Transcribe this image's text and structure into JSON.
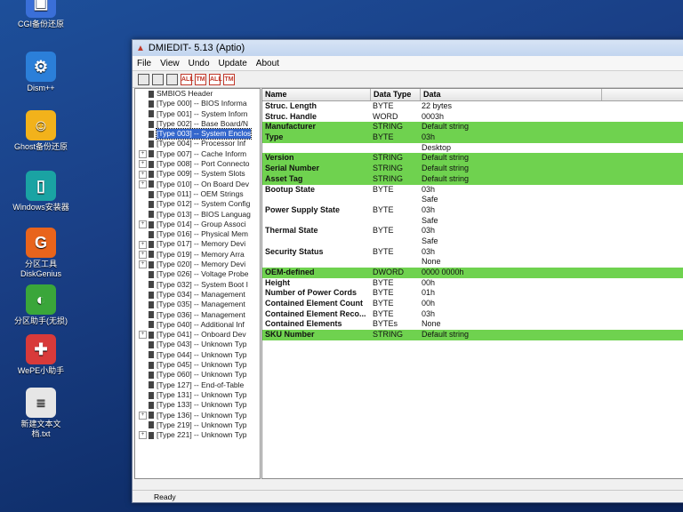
{
  "desktop": {
    "icons": [
      {
        "label": "CGI备份还原",
        "glyph": "▣",
        "color": "#3a6fd8",
        "icon": "backup-icon"
      },
      {
        "label": "Dism++",
        "glyph": "⚙",
        "color": "#2b7fd9",
        "icon": "gear-icon"
      },
      {
        "label": "Ghost备份还原",
        "glyph": "☺",
        "color": "#f2b21b",
        "icon": "ghost-icon"
      },
      {
        "label": "Windows安装器",
        "glyph": "▯",
        "color": "#1aa3a3",
        "icon": "installer-icon"
      },
      {
        "label": "分区工具DiskGenius",
        "glyph": "G",
        "color": "#e8641c",
        "icon": "diskgenius-icon"
      },
      {
        "label": "分区助手(无损)",
        "glyph": "◐",
        "color": "#3aa63a",
        "icon": "partition-assistant-icon"
      },
      {
        "label": "WePE小助手",
        "glyph": "✚",
        "color": "#d83a3a",
        "icon": "lifebuoy-icon"
      },
      {
        "label": "新建文本文档.txt",
        "glyph": "≡",
        "color": "#e6e6e6",
        "icon": "text-file-icon"
      }
    ]
  },
  "window": {
    "title": "DMIEDIT- 5.13 (Aptio)",
    "menu": [
      "File",
      "View",
      "Undo",
      "Update",
      "About"
    ],
    "toolbar": [
      {
        "label": "",
        "icon": "save-icon",
        "style": ""
      },
      {
        "label": "",
        "icon": "save-all-icon",
        "style": ""
      },
      {
        "label": "",
        "icon": "export-icon",
        "style": ""
      },
      {
        "label": "ALL",
        "icon": "update-all-icon",
        "style": "red"
      },
      {
        "label": "TM",
        "icon": "update-tm-icon",
        "style": "red"
      },
      {
        "label": "ALL",
        "icon": "undo-all-icon",
        "style": "red"
      },
      {
        "label": "TM",
        "icon": "undo-tm-icon",
        "style": "red"
      }
    ],
    "status": "Ready"
  },
  "tree": [
    {
      "label": "SMBIOS Header",
      "exp": false,
      "selected": false
    },
    {
      "label": "[Type 000] -- BIOS Informa",
      "exp": false,
      "selected": false
    },
    {
      "label": "[Type 001] -- System Inforn",
      "exp": false,
      "selected": false
    },
    {
      "label": "[Type 002] -- Base Board/N",
      "exp": false,
      "selected": false
    },
    {
      "label": "[Type 003] -- System Enclos",
      "exp": false,
      "selected": true
    },
    {
      "label": "[Type 004] -- Processor Inf",
      "exp": false,
      "selected": false
    },
    {
      "label": "[Type 007] -- Cache Inform",
      "exp": true,
      "selected": false
    },
    {
      "label": "[Type 008] -- Port Connecto",
      "exp": true,
      "selected": false
    },
    {
      "label": "[Type 009] -- System Slots",
      "exp": true,
      "selected": false
    },
    {
      "label": "[Type 010] -- On Board Dev",
      "exp": true,
      "selected": false
    },
    {
      "label": "[Type 011] -- OEM Strings",
      "exp": false,
      "selected": false
    },
    {
      "label": "[Type 012] -- System Config",
      "exp": false,
      "selected": false
    },
    {
      "label": "[Type 013] -- BIOS Languag",
      "exp": false,
      "selected": false
    },
    {
      "label": "[Type 014] -- Group Associ",
      "exp": true,
      "selected": false
    },
    {
      "label": "[Type 016] -- Physical Mem",
      "exp": false,
      "selected": false
    },
    {
      "label": "[Type 017] -- Memory Devi",
      "exp": true,
      "selected": false
    },
    {
      "label": "[Type 019] -- Memory Arra",
      "exp": true,
      "selected": false
    },
    {
      "label": "[Type 020] -- Memory Devi",
      "exp": true,
      "selected": false
    },
    {
      "label": "[Type 026] -- Voltage Probe",
      "exp": false,
      "selected": false
    },
    {
      "label": "[Type 032] -- System Boot I",
      "exp": false,
      "selected": false
    },
    {
      "label": "[Type 034] -- Management",
      "exp": false,
      "selected": false
    },
    {
      "label": "[Type 035] -- Management",
      "exp": false,
      "selected": false
    },
    {
      "label": "[Type 036] -- Management",
      "exp": false,
      "selected": false
    },
    {
      "label": "[Type 040] -- Additional Inf",
      "exp": false,
      "selected": false
    },
    {
      "label": "[Type 041] -- Onboard Dev",
      "exp": true,
      "selected": false
    },
    {
      "label": "[Type 043] -- Unknown Typ",
      "exp": false,
      "selected": false
    },
    {
      "label": "[Type 044] -- Unknown Typ",
      "exp": false,
      "selected": false
    },
    {
      "label": "[Type 045] -- Unknown Typ",
      "exp": false,
      "selected": false
    },
    {
      "label": "[Type 060] -- Unknown Typ",
      "exp": false,
      "selected": false
    },
    {
      "label": "[Type 127] -- End-of-Table",
      "exp": false,
      "selected": false
    },
    {
      "label": "[Type 131] -- Unknown Typ",
      "exp": false,
      "selected": false
    },
    {
      "label": "[Type 133] -- Unknown Typ",
      "exp": false,
      "selected": false
    },
    {
      "label": "[Type 136] -- Unknown Typ",
      "exp": true,
      "selected": false
    },
    {
      "label": "[Type 219] -- Unknown Typ",
      "exp": false,
      "selected": false
    },
    {
      "label": "[Type 221] -- Unknown Typ",
      "exp": true,
      "selected": false
    }
  ],
  "grid": {
    "headers": [
      "Name",
      "Data Type",
      "Data"
    ],
    "rows": [
      {
        "name": "Struc. Length",
        "type": "BYTE",
        "data": "22 bytes",
        "hl": false
      },
      {
        "name": "Struc. Handle",
        "type": "WORD",
        "data": "0003h",
        "hl": false
      },
      {
        "name": "Manufacturer",
        "type": "STRING",
        "data": "Default string",
        "hl": true
      },
      {
        "name": "Type",
        "type": "BYTE",
        "data": "03h",
        "hl": true
      },
      {
        "name": "",
        "type": "",
        "data": "Desktop",
        "hl": false
      },
      {
        "name": "Version",
        "type": "STRING",
        "data": "Default string",
        "hl": true
      },
      {
        "name": "Serial Number",
        "type": "STRING",
        "data": "Default string",
        "hl": true
      },
      {
        "name": "Asset Tag",
        "type": "STRING",
        "data": "Default string",
        "hl": true
      },
      {
        "name": "Bootup State",
        "type": "BYTE",
        "data": "03h",
        "hl": false
      },
      {
        "name": "",
        "type": "",
        "data": "Safe",
        "hl": false
      },
      {
        "name": "Power Supply State",
        "type": "BYTE",
        "data": "03h",
        "hl": false
      },
      {
        "name": "",
        "type": "",
        "data": "Safe",
        "hl": false
      },
      {
        "name": "Thermal State",
        "type": "BYTE",
        "data": "03h",
        "hl": false
      },
      {
        "name": "",
        "type": "",
        "data": "Safe",
        "hl": false
      },
      {
        "name": "Security Status",
        "type": "BYTE",
        "data": "03h",
        "hl": false
      },
      {
        "name": "",
        "type": "",
        "data": "None",
        "hl": false
      },
      {
        "name": "OEM-defined",
        "type": "DWORD",
        "data": "0000 0000h",
        "hl": true
      },
      {
        "name": "Height",
        "type": "BYTE",
        "data": "00h",
        "hl": false
      },
      {
        "name": "Number of Power Cords",
        "type": "BYTE",
        "data": "01h",
        "hl": false
      },
      {
        "name": "Contained Element Count",
        "type": "BYTE",
        "data": "00h",
        "hl": false
      },
      {
        "name": "Contained Element Reco...",
        "type": "BYTE",
        "data": "03h",
        "hl": false
      },
      {
        "name": "Contained Elements",
        "type": "BYTEs",
        "data": "None",
        "hl": false
      },
      {
        "name": "SKU Number",
        "type": "STRING",
        "data": "Default string",
        "hl": true
      }
    ]
  }
}
